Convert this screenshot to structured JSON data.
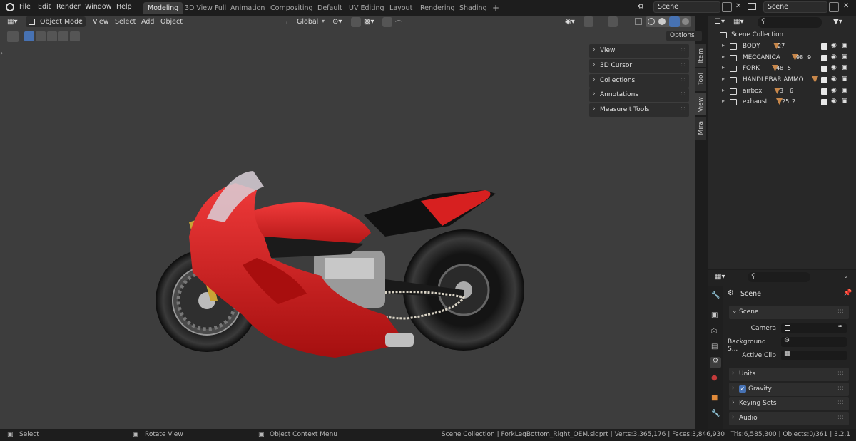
{
  "menu": [
    "File",
    "Edit",
    "Render",
    "Window",
    "Help"
  ],
  "workspaces": [
    {
      "label": "Modeling",
      "active": true
    },
    {
      "label": "3D View Full",
      "active": false
    },
    {
      "label": "Animation",
      "active": false
    },
    {
      "label": "Compositing",
      "active": false
    },
    {
      "label": "Default",
      "active": false
    },
    {
      "label": "UV Editing",
      "active": false
    },
    {
      "label": "Layout",
      "active": false
    },
    {
      "label": "Rendering",
      "active": false
    },
    {
      "label": "Shading",
      "active": false
    }
  ],
  "add_workspace": "+",
  "scene_name": "Scene",
  "view_layer_name": "Scene",
  "viewport_header": {
    "mode": "Object Mode",
    "menus": [
      "View",
      "Select",
      "Add",
      "Object"
    ],
    "transform_orientation": "Global",
    "options_label": "Options"
  },
  "npanel": {
    "items": [
      "View",
      "3D Cursor",
      "Collections",
      "Annotations",
      "MeasureIt Tools"
    ],
    "tabs": [
      "Item",
      "Tool",
      "View",
      "Mira"
    ]
  },
  "outliner": {
    "root": "Scene Collection",
    "rows": [
      {
        "name": "BODY",
        "count": "27",
        "extra": ""
      },
      {
        "name": "MECCANICA",
        "count": "98",
        "extra": "9"
      },
      {
        "name": "FORK",
        "count": "48",
        "extra": "5"
      },
      {
        "name": "HANDLEBAR AMMO",
        "count": "",
        "extra": ""
      },
      {
        "name": "airbox",
        "count": "3",
        "extra": "6"
      },
      {
        "name": "exhaust",
        "count": "25",
        "extra": "2"
      }
    ]
  },
  "properties": {
    "context": "Scene",
    "section": "Scene",
    "fields": [
      {
        "label": "Camera",
        "value": ""
      },
      {
        "label": "Background S...",
        "value": ""
      },
      {
        "label": "Active Clip",
        "value": ""
      }
    ],
    "collapsed": [
      {
        "label": "Units",
        "checkbox": false
      },
      {
        "label": "Gravity",
        "checkbox": true
      },
      {
        "label": "Keying Sets",
        "checkbox": false
      },
      {
        "label": "Audio",
        "checkbox": false
      }
    ]
  },
  "statusbar": {
    "left": [
      "Select",
      "Rotate View",
      "Object Context Menu"
    ],
    "right": "Scene Collection | ForkLegBottom_Right_OEM.sldprt | Verts:3,365,176 | Faces:3,846,930 | Tris:6,585,300 | Objects:0/361 | 3.2.1"
  },
  "colors": {
    "accent": "#4772b3",
    "motorcycle_red": "#d21a1a",
    "badge_orange": "#c8874a"
  }
}
